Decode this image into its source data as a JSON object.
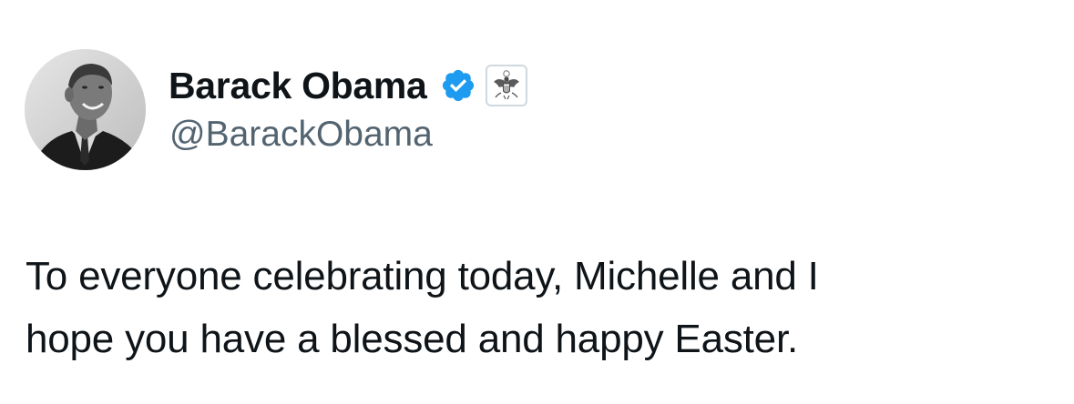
{
  "author": {
    "display_name": "Barack Obama",
    "handle": "@BarackObama",
    "avatar_icon": "profile-photo",
    "verified_icon": "verified-badge-icon",
    "affiliation_icon": "us-government-seal-icon"
  },
  "tweet": {
    "text": "To everyone celebrating today, Michelle and I\nhope you have a blessed and happy Easter."
  },
  "colors": {
    "text_primary": "#0f1419",
    "text_secondary": "#536471",
    "verified_blue": "#1d9bf0"
  }
}
